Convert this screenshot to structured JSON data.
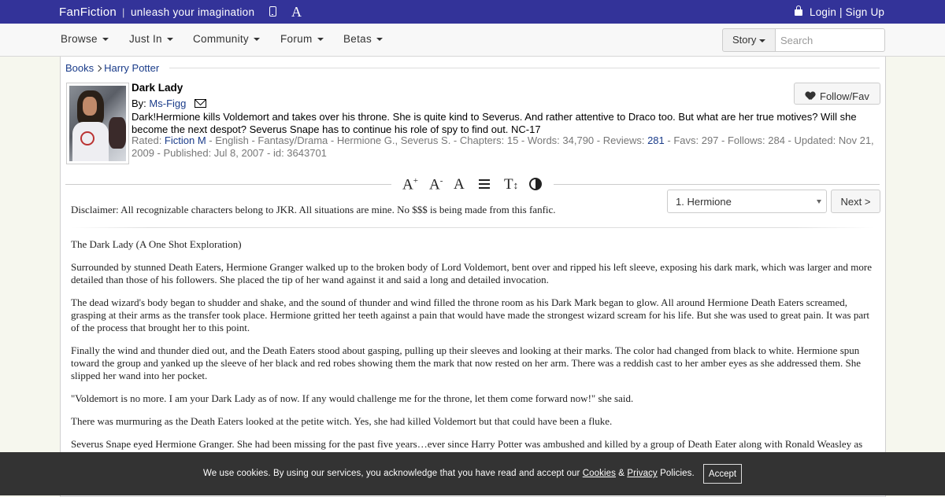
{
  "topbar": {
    "brand": "FanFiction",
    "separator": "|",
    "tagline": "unleash your imagination",
    "login": "Login",
    "auth_sep": "|",
    "signup": "Sign Up"
  },
  "nav": {
    "items": [
      "Browse",
      "Just In",
      "Community",
      "Forum",
      "Betas"
    ],
    "search_type": "Story",
    "search_placeholder": "Search"
  },
  "breadcrumb": {
    "parent": "Books",
    "current": "Harry Potter"
  },
  "story": {
    "title": "Dark Lady",
    "by_label": "By:",
    "author": "Ms-Figg",
    "follow_label": "Follow/Fav",
    "summary": "Dark!Hermione kills Voldemort and takes over his throne. She is quite kind to Severus. And rather attentive to Draco too. But what are her true motives? Will she become the next despot? Severus Snape has to continue his role of spy to find out. NC-17",
    "meta": {
      "rated_label": "Rated: ",
      "rating": "Fiction M",
      "part1": " - English - Fantasy/Drama - Hermione G., Severus S. - Chapters: 15 - Words: 34,790 - Reviews: ",
      "reviews": "281",
      "part2": " - Favs: 297 - Follows: 284 - Updated: Nov 21, 2009 - Published: Jul 8, 2007 - id: 3643701"
    }
  },
  "tools": {
    "font_increase": "A",
    "font_increase_sup": "+",
    "font_decrease": "A",
    "font_decrease_sup": "-",
    "font_family": "A",
    "text_size": "T",
    "text_size_suffix": "↕"
  },
  "chapter_nav": {
    "selected": "1. Hermione",
    "next_label": "Next >"
  },
  "disclaimer": "Disclaimer: All recognizable characters belong to JKR. All situations are mine. No $$$ is being made from this fanfic.",
  "body": {
    "p1": "The Dark Lady (A One Shot Exploration)",
    "p2": "Surrounded by stunned Death Eaters, Hermione Granger walked up to the broken body of Lord Voldemort, bent over and ripped his left sleeve, exposing his dark mark, which was larger and more detailed than those of his followers. She placed the tip of her wand against it and said a long and detailed invocation.",
    "p3": "The dead wizard's body began to shudder and shake, and the sound of thunder and wind filled the throne room as his Dark Mark began to glow. All around Hermione Death Eaters screamed, grasping at their arms as the transfer took place. Hermione gritted her teeth against a pain that would have made the strongest wizard scream for his life. But she was used to great pain. It was part of the process that brought her to this point.",
    "p4": "Finally the wind and thunder died out, and the Death Eaters stood about gasping, pulling up their sleeves and looking at their marks. The color had changed from black to white. Hermione spun toward the group and yanked up the sleeve of her black and red robes showing them the mark that now rested on her arm. There was a reddish cast to her amber eyes as she addressed them. She slipped her wand into her pocket.",
    "p5": "\"Voldemort is no more. I am your Dark Lady as of now. If any would challenge me for the throne, let them come forward now!\" she said.",
    "p6": "There was murmuring as the Death Eaters looked at the petite witch. Yes, she had killed Voldemort but that could have been a fluke.",
    "p7": "Severus Snape eyed Hermione Granger. She had been missing for the past five years…ever since Harry Potter was ambushed and killed by a group of Death Eater along with Ronald Weasley as"
  },
  "cookie": {
    "text1": "We use cookies. By using our services, you acknowledge that you have read and accept our ",
    "cookies_link": "Cookies",
    "amp": " & ",
    "privacy_link": "Privacy",
    "text2": " Policies.",
    "accept": "Accept"
  },
  "icons": [
    "phone-icon",
    "font-icon",
    "lock-icon",
    "mail-icon",
    "heart-icon",
    "paragraph-width-icon",
    "contrast-icon"
  ],
  "colors": {
    "topbar_bg": "#333399",
    "link": "#1a3c8a",
    "cookie_bg": "#333333"
  }
}
